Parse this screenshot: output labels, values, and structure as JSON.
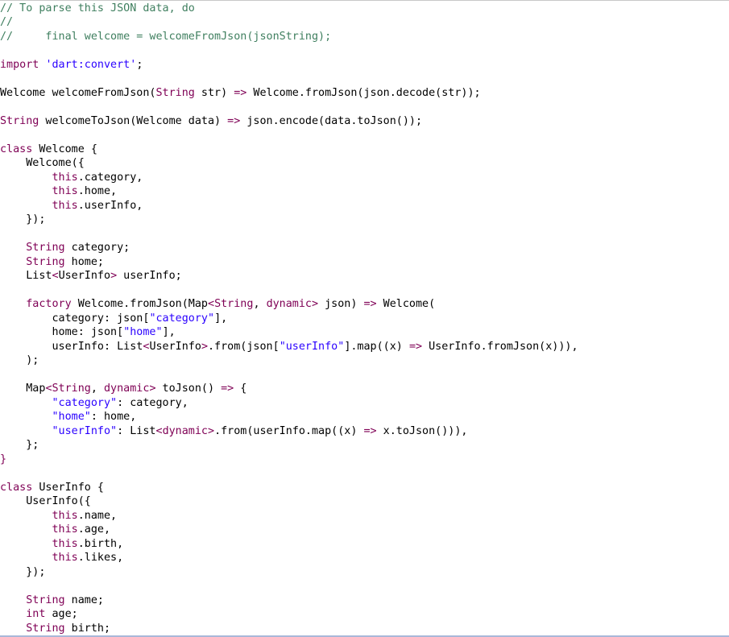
{
  "colors": {
    "background": "#ffffff",
    "plain": "#000000",
    "comment": "#3f7f5f",
    "keyword": "#7f0055",
    "string": "#2a00ff",
    "type": "#7f0055",
    "prop": "#0000c0"
  },
  "code": {
    "lines": [
      {
        "tokens": [
          {
            "t": "comment",
            "v": "// To parse this JSON data, do"
          }
        ]
      },
      {
        "tokens": [
          {
            "t": "comment",
            "v": "//"
          }
        ]
      },
      {
        "tokens": [
          {
            "t": "comment",
            "v": "//     final welcome = welcomeFromJson(jsonString);"
          }
        ]
      },
      {
        "tokens": []
      },
      {
        "tokens": [
          {
            "t": "keyword",
            "v": "import"
          },
          {
            "t": "plain",
            "v": " "
          },
          {
            "t": "string",
            "v": "'dart:convert'"
          },
          {
            "t": "plain",
            "v": ";"
          }
        ]
      },
      {
        "tokens": []
      },
      {
        "tokens": [
          {
            "t": "plain",
            "v": "Welcome welcomeFromJson("
          },
          {
            "t": "type",
            "v": "String"
          },
          {
            "t": "plain",
            "v": " str) "
          },
          {
            "t": "keyword",
            "v": "=>"
          },
          {
            "t": "plain",
            "v": " Welcome.fromJson(json.decode(str));"
          }
        ]
      },
      {
        "tokens": []
      },
      {
        "tokens": [
          {
            "t": "type",
            "v": "String"
          },
          {
            "t": "plain",
            "v": " welcomeToJson(Welcome data) "
          },
          {
            "t": "keyword",
            "v": "=>"
          },
          {
            "t": "plain",
            "v": " json.encode(data.toJson());"
          }
        ]
      },
      {
        "tokens": []
      },
      {
        "tokens": [
          {
            "t": "keyword",
            "v": "class"
          },
          {
            "t": "plain",
            "v": " Welcome {"
          }
        ]
      },
      {
        "tokens": [
          {
            "t": "plain",
            "v": "    Welcome({"
          }
        ]
      },
      {
        "tokens": [
          {
            "t": "plain",
            "v": "        "
          },
          {
            "t": "keyword",
            "v": "this"
          },
          {
            "t": "plain",
            "v": ".category,"
          }
        ]
      },
      {
        "tokens": [
          {
            "t": "plain",
            "v": "        "
          },
          {
            "t": "keyword",
            "v": "this"
          },
          {
            "t": "plain",
            "v": ".home,"
          }
        ]
      },
      {
        "tokens": [
          {
            "t": "plain",
            "v": "        "
          },
          {
            "t": "keyword",
            "v": "this"
          },
          {
            "t": "plain",
            "v": ".userInfo,"
          }
        ]
      },
      {
        "tokens": [
          {
            "t": "plain",
            "v": "    });"
          }
        ]
      },
      {
        "tokens": []
      },
      {
        "tokens": [
          {
            "t": "plain",
            "v": "    "
          },
          {
            "t": "type",
            "v": "String"
          },
          {
            "t": "plain",
            "v": " category;"
          }
        ]
      },
      {
        "tokens": [
          {
            "t": "plain",
            "v": "    "
          },
          {
            "t": "type",
            "v": "String"
          },
          {
            "t": "plain",
            "v": " home;"
          }
        ]
      },
      {
        "tokens": [
          {
            "t": "plain",
            "v": "    List"
          },
          {
            "t": "keyword",
            "v": "<"
          },
          {
            "t": "plain",
            "v": "UserInfo"
          },
          {
            "t": "keyword",
            "v": ">"
          },
          {
            "t": "plain",
            "v": " userInfo;"
          }
        ]
      },
      {
        "tokens": []
      },
      {
        "tokens": [
          {
            "t": "plain",
            "v": "    "
          },
          {
            "t": "keyword",
            "v": "factory"
          },
          {
            "t": "plain",
            "v": " Welcome.fromJson(Map"
          },
          {
            "t": "keyword",
            "v": "<"
          },
          {
            "t": "type",
            "v": "String"
          },
          {
            "t": "plain",
            "v": ", "
          },
          {
            "t": "keyword",
            "v": "dynamic"
          },
          {
            "t": "keyword",
            "v": ">"
          },
          {
            "t": "plain",
            "v": " json) "
          },
          {
            "t": "keyword",
            "v": "=>"
          },
          {
            "t": "plain",
            "v": " Welcome("
          }
        ]
      },
      {
        "tokens": [
          {
            "t": "plain",
            "v": "        category: json["
          },
          {
            "t": "string",
            "v": "\"category\""
          },
          {
            "t": "plain",
            "v": "],"
          }
        ]
      },
      {
        "tokens": [
          {
            "t": "plain",
            "v": "        home: json["
          },
          {
            "t": "string",
            "v": "\"home\""
          },
          {
            "t": "plain",
            "v": "],"
          }
        ]
      },
      {
        "tokens": [
          {
            "t": "plain",
            "v": "        userInfo: List"
          },
          {
            "t": "keyword",
            "v": "<"
          },
          {
            "t": "plain",
            "v": "UserInfo"
          },
          {
            "t": "keyword",
            "v": ">"
          },
          {
            "t": "plain",
            "v": ".from(json["
          },
          {
            "t": "string",
            "v": "\"userInfo\""
          },
          {
            "t": "plain",
            "v": "].map((x) "
          },
          {
            "t": "keyword",
            "v": "=>"
          },
          {
            "t": "plain",
            "v": " UserInfo.fromJson(x))),"
          }
        ]
      },
      {
        "tokens": [
          {
            "t": "plain",
            "v": "    );"
          }
        ]
      },
      {
        "tokens": []
      },
      {
        "tokens": [
          {
            "t": "plain",
            "v": "    Map"
          },
          {
            "t": "keyword",
            "v": "<"
          },
          {
            "t": "type",
            "v": "String"
          },
          {
            "t": "plain",
            "v": ", "
          },
          {
            "t": "keyword",
            "v": "dynamic"
          },
          {
            "t": "keyword",
            "v": ">"
          },
          {
            "t": "plain",
            "v": " toJson() "
          },
          {
            "t": "keyword",
            "v": "=>"
          },
          {
            "t": "plain",
            "v": " {"
          }
        ]
      },
      {
        "tokens": [
          {
            "t": "plain",
            "v": "        "
          },
          {
            "t": "string",
            "v": "\"category\""
          },
          {
            "t": "plain",
            "v": ": category,"
          }
        ]
      },
      {
        "tokens": [
          {
            "t": "plain",
            "v": "        "
          },
          {
            "t": "string",
            "v": "\"home\""
          },
          {
            "t": "plain",
            "v": ": home,"
          }
        ]
      },
      {
        "tokens": [
          {
            "t": "plain",
            "v": "        "
          },
          {
            "t": "string",
            "v": "\"userInfo\""
          },
          {
            "t": "plain",
            "v": ": List"
          },
          {
            "t": "keyword",
            "v": "<"
          },
          {
            "t": "keyword",
            "v": "dynamic"
          },
          {
            "t": "keyword",
            "v": ">"
          },
          {
            "t": "plain",
            "v": ".from(userInfo.map((x) "
          },
          {
            "t": "keyword",
            "v": "=>"
          },
          {
            "t": "plain",
            "v": " x.toJson())),"
          }
        ]
      },
      {
        "tokens": [
          {
            "t": "plain",
            "v": "    };"
          }
        ]
      },
      {
        "tokens": [
          {
            "t": "keyword",
            "v": "}"
          }
        ]
      },
      {
        "tokens": []
      },
      {
        "tokens": [
          {
            "t": "keyword",
            "v": "class"
          },
          {
            "t": "plain",
            "v": " UserInfo {"
          }
        ]
      },
      {
        "tokens": [
          {
            "t": "plain",
            "v": "    UserInfo({"
          }
        ]
      },
      {
        "tokens": [
          {
            "t": "plain",
            "v": "        "
          },
          {
            "t": "keyword",
            "v": "this"
          },
          {
            "t": "plain",
            "v": ".name,"
          }
        ]
      },
      {
        "tokens": [
          {
            "t": "plain",
            "v": "        "
          },
          {
            "t": "keyword",
            "v": "this"
          },
          {
            "t": "plain",
            "v": ".age,"
          }
        ]
      },
      {
        "tokens": [
          {
            "t": "plain",
            "v": "        "
          },
          {
            "t": "keyword",
            "v": "this"
          },
          {
            "t": "plain",
            "v": ".birth,"
          }
        ]
      },
      {
        "tokens": [
          {
            "t": "plain",
            "v": "        "
          },
          {
            "t": "keyword",
            "v": "this"
          },
          {
            "t": "plain",
            "v": ".likes,"
          }
        ]
      },
      {
        "tokens": [
          {
            "t": "plain",
            "v": "    });"
          }
        ]
      },
      {
        "tokens": []
      },
      {
        "tokens": [
          {
            "t": "plain",
            "v": "    "
          },
          {
            "t": "type",
            "v": "String"
          },
          {
            "t": "plain",
            "v": " name;"
          }
        ]
      },
      {
        "tokens": [
          {
            "t": "plain",
            "v": "    "
          },
          {
            "t": "keyword",
            "v": "int"
          },
          {
            "t": "plain",
            "v": " age;"
          }
        ]
      },
      {
        "tokens": [
          {
            "t": "plain",
            "v": "    "
          },
          {
            "t": "type",
            "v": "String"
          },
          {
            "t": "plain",
            "v": " birth;"
          }
        ]
      }
    ]
  }
}
